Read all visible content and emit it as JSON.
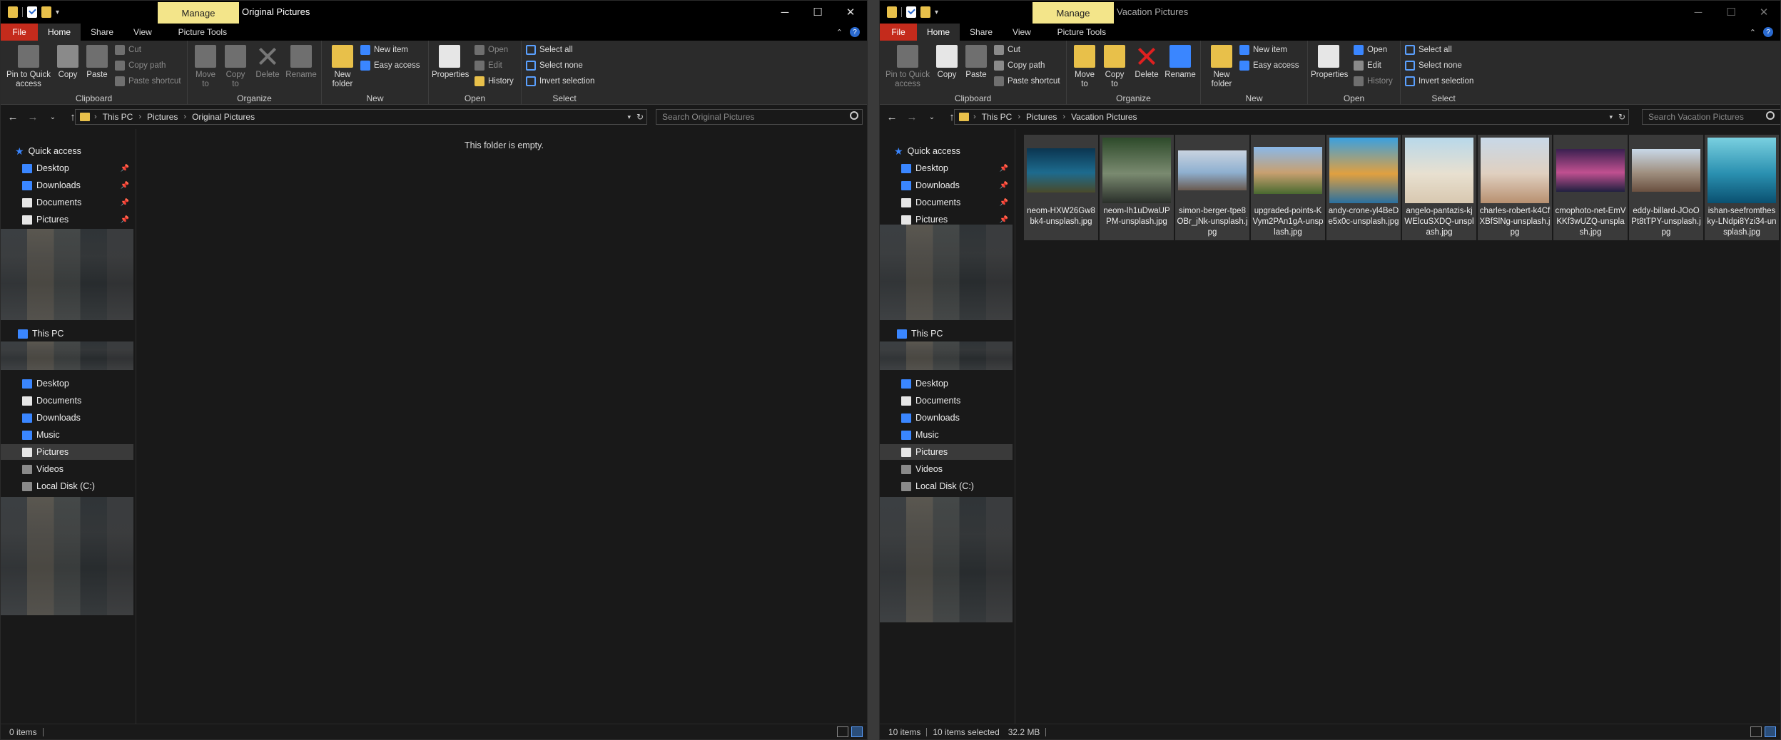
{
  "left": {
    "title": "Original Pictures",
    "manage_tab": "Manage",
    "tabs": {
      "file": "File",
      "home": "Home",
      "share": "Share",
      "view": "View",
      "picture_tools": "Picture Tools"
    },
    "ribbon": {
      "pin": "Pin to Quick access",
      "copy": "Copy",
      "paste": "Paste",
      "cut": "Cut",
      "copy_path": "Copy path",
      "paste_shortcut": "Paste shortcut",
      "clipboard": "Clipboard",
      "move_to": "Move to",
      "copy_to": "Copy to",
      "delete": "Delete",
      "rename": "Rename",
      "organize": "Organize",
      "new_folder": "New folder",
      "new_item": "New item",
      "easy_access": "Easy access",
      "new": "New",
      "properties": "Properties",
      "open": "Open",
      "edit": "Edit",
      "history": "History",
      "open_group": "Open",
      "select_all": "Select all",
      "select_none": "Select none",
      "invert_selection": "Invert selection",
      "select": "Select"
    },
    "breadcrumb": [
      "This PC",
      "Pictures",
      "Original Pictures"
    ],
    "search_placeholder": "Search Original Pictures",
    "nav": {
      "quick_access": "Quick access",
      "qa_items": [
        "Desktop",
        "Downloads",
        "Documents",
        "Pictures"
      ],
      "this_pc": "This PC",
      "pc_items": [
        "Desktop",
        "Documents",
        "Downloads",
        "Music",
        "Pictures",
        "Videos",
        "Local Disk (C:)"
      ]
    },
    "empty_message": "This folder is empty.",
    "status": {
      "items": "0 items"
    }
  },
  "right": {
    "title": "Vacation Pictures",
    "manage_tab": "Manage",
    "tabs": {
      "file": "File",
      "home": "Home",
      "share": "Share",
      "view": "View",
      "picture_tools": "Picture Tools"
    },
    "ribbon": {
      "pin": "Pin to Quick access",
      "copy": "Copy",
      "paste": "Paste",
      "cut": "Cut",
      "copy_path": "Copy path",
      "paste_shortcut": "Paste shortcut",
      "clipboard": "Clipboard",
      "move_to": "Move to",
      "copy_to": "Copy to",
      "delete": "Delete",
      "rename": "Rename",
      "organize": "Organize",
      "new_folder": "New folder",
      "new_item": "New item",
      "easy_access": "Easy access",
      "new": "New",
      "properties": "Properties",
      "open": "Open",
      "edit": "Edit",
      "history": "History",
      "open_group": "Open",
      "select_all": "Select all",
      "select_none": "Select none",
      "invert_selection": "Invert selection",
      "select": "Select"
    },
    "breadcrumb": [
      "This PC",
      "Pictures",
      "Vacation Pictures"
    ],
    "search_placeholder": "Search Vacation Pictures",
    "nav": {
      "quick_access": "Quick access",
      "qa_items": [
        "Desktop",
        "Downloads",
        "Documents",
        "Pictures"
      ],
      "this_pc": "This PC",
      "pc_items": [
        "Desktop",
        "Documents",
        "Downloads",
        "Music",
        "Pictures",
        "Videos",
        "Local Disk (C:)"
      ]
    },
    "files": [
      {
        "name": "neom-HXW26Gw8bk4-unsplash.jpg",
        "colors": [
          "#0b3550",
          "#1d6b8e",
          "#4a4a2a"
        ]
      },
      {
        "name": "neom-lh1uDwaUPPM-unsplash.jpg",
        "colors": [
          "#2d4a2a",
          "#7a8a70",
          "#2a2f2a"
        ]
      },
      {
        "name": "simon-berger-tpe8OBr_jNk-unsplash.jpg",
        "colors": [
          "#c9d3e0",
          "#8fb0d0",
          "#6a5a50"
        ]
      },
      {
        "name": "upgraded-points-KVym2PAn1gA-unsplash.jpg",
        "colors": [
          "#8ab8e8",
          "#c8a070",
          "#4a6a30"
        ]
      },
      {
        "name": "andy-crone-yl4BeDe5x0c-unsplash.jpg",
        "colors": [
          "#3aa0e0",
          "#e0a040",
          "#2a70a0"
        ]
      },
      {
        "name": "angelo-pantazis-kjWElcuSXDQ-unsplash.jpg",
        "colors": [
          "#b8d8ea",
          "#e8e0d0",
          "#d8c8b0"
        ]
      },
      {
        "name": "charles-robert-k4CfXBfSlNg-unsplash.jpg",
        "colors": [
          "#c8d8e8",
          "#e0d0c0",
          "#b89070"
        ]
      },
      {
        "name": "cmophoto-net-EmVKKf3wUZQ-unsplash.jpg",
        "colors": [
          "#3a2050",
          "#c05090",
          "#202040"
        ]
      },
      {
        "name": "eddy-billard-JOoOPt8tTPY-unsplash.jpg",
        "colors": [
          "#c8d8e8",
          "#a09080",
          "#6a5040"
        ]
      },
      {
        "name": "ishan-seefromthesky-LNdpi8Yzi34-unsplash.jpg",
        "colors": [
          "#7ad0e0",
          "#2a90b0",
          "#0a5070"
        ]
      }
    ],
    "status": {
      "items": "10 items",
      "selected": "10 items selected",
      "size": "32.2 MB"
    }
  },
  "icons": {
    "minimize": "minimize-icon",
    "maximize": "maximize-icon",
    "close": "close-icon",
    "back": "back-arrow-icon",
    "forward": "forward-arrow-icon",
    "up": "up-arrow-icon",
    "search": "search-icon",
    "help": "help-icon"
  }
}
